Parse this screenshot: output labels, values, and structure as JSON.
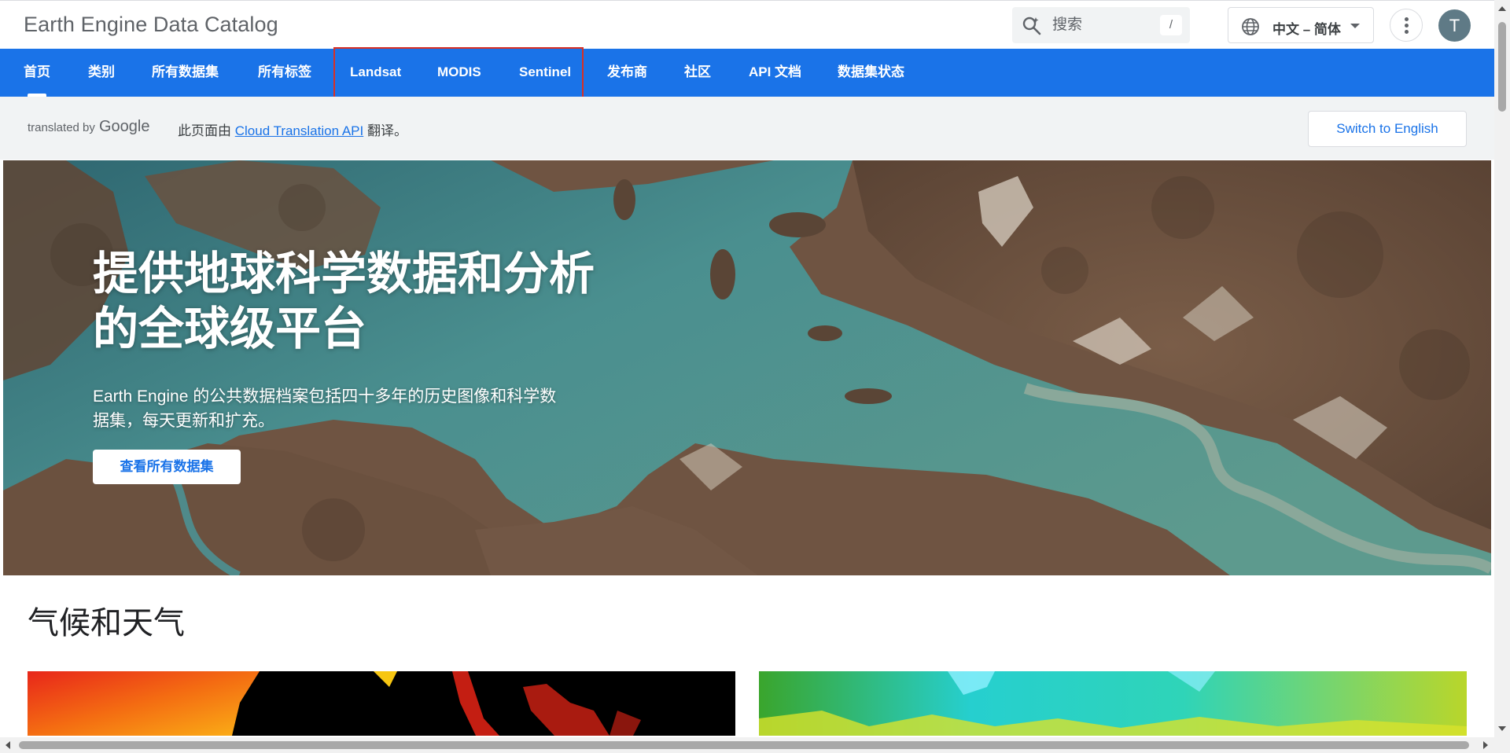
{
  "header": {
    "site_title": "Earth Engine Data Catalog",
    "search": {
      "placeholder": "搜索",
      "shortcut": "/"
    },
    "language": {
      "selected": "中文 – 简体"
    },
    "avatar_initial": "T"
  },
  "nav": {
    "tabs": [
      {
        "label": "首页",
        "active": true
      },
      {
        "label": "类别"
      },
      {
        "label": "所有数据集"
      },
      {
        "label": "所有标签"
      },
      {
        "label": "Landsat"
      },
      {
        "label": "MODIS"
      },
      {
        "label": "Sentinel"
      },
      {
        "label": "发布商"
      },
      {
        "label": "社区"
      },
      {
        "label": "API 文档"
      },
      {
        "label": "数据集状态"
      }
    ],
    "highlight_color": "#d93025"
  },
  "translation": {
    "translated_by": "translated by",
    "google": "Google",
    "note_prefix": "此页面由 ",
    "note_link": "Cloud Translation API",
    "note_suffix": " 翻译。",
    "switch_button": "Switch to English"
  },
  "hero": {
    "title": "提供地球科学数据和分析的全球级平台",
    "subtitle": "Earth Engine 的公共数据档案包括四十多年的历史图像和科学数据集，每天更新和扩充。",
    "cta": "查看所有数据集"
  },
  "section": {
    "title": "气候和天气"
  },
  "colors": {
    "brand_blue": "#1a73e8",
    "nav_text": "#ffffff",
    "page_bg": "#ffffff",
    "translate_bar_bg": "#f1f3f4"
  }
}
